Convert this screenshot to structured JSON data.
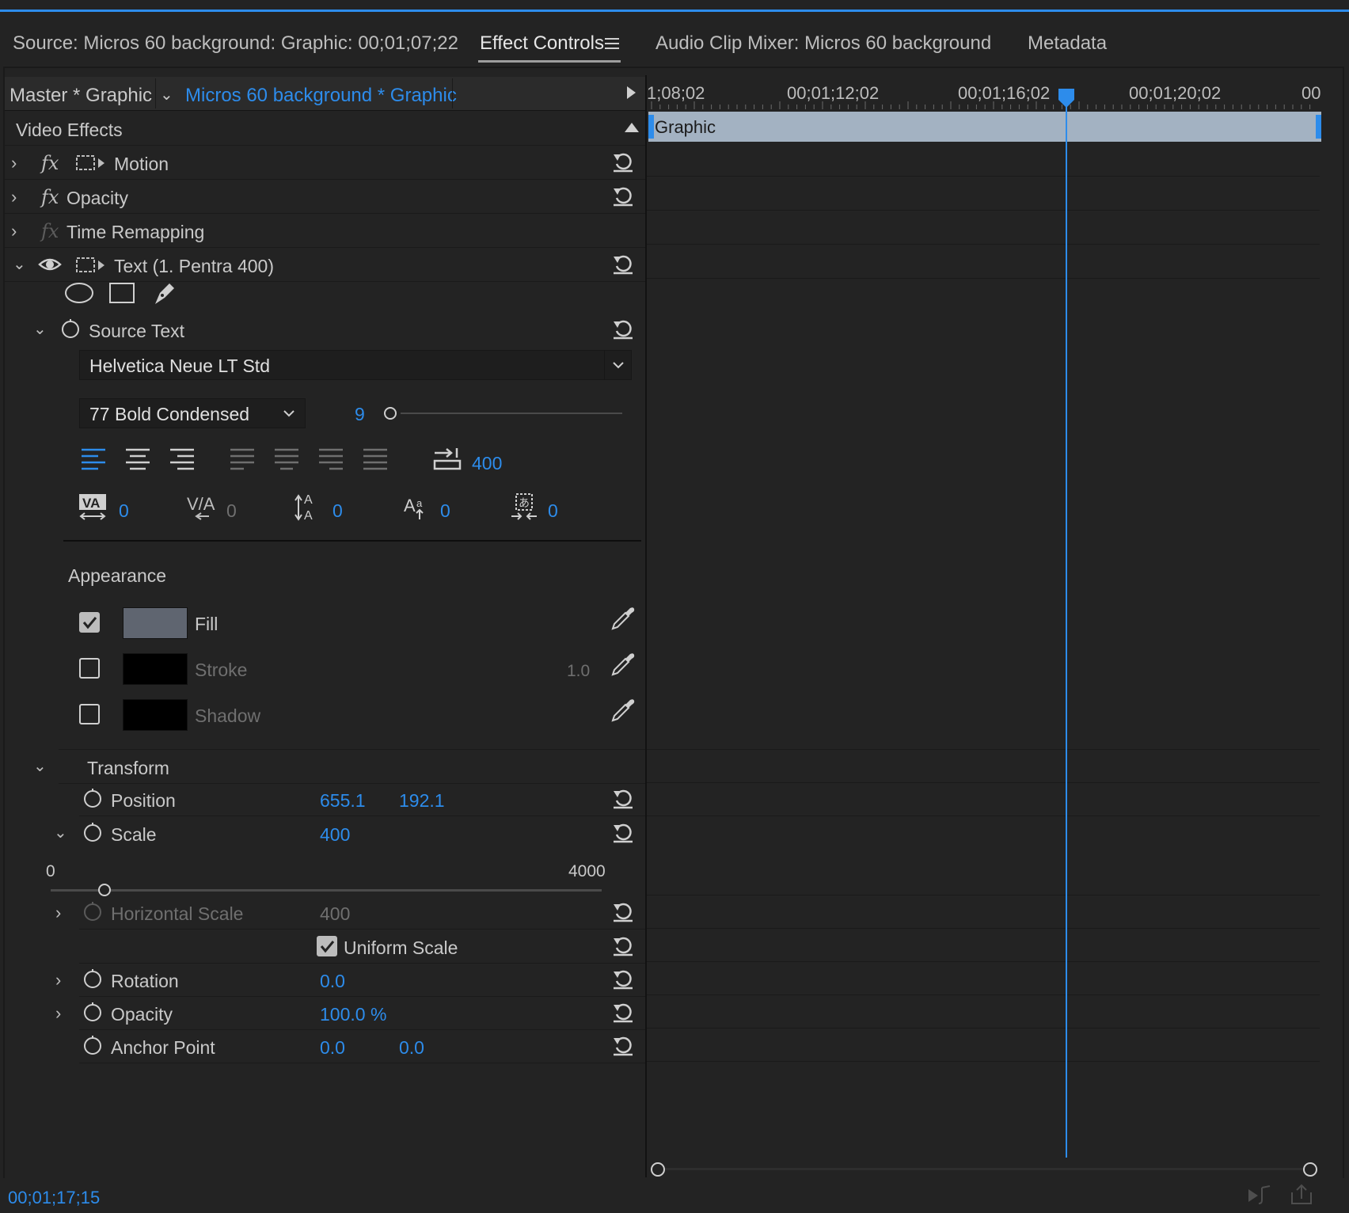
{
  "tabs": {
    "source": "Source: Micros 60 background: Graphic: 00;01;07;22",
    "effect_controls": "Effect Controls",
    "audio_clip_mixer": "Audio Clip Mixer: Micros 60 background",
    "metadata": "Metadata"
  },
  "header": {
    "master": "Master * Graphic",
    "clip": "Micros 60 background * Graphic"
  },
  "video_effects_label": "Video Effects",
  "effects": {
    "motion": "Motion",
    "opacity": "Opacity",
    "time_remapping": "Time Remapping",
    "text_layer": "Text (1. Pentra 400)"
  },
  "source_text": {
    "label": "Source Text",
    "font_family": "Helvetica Neue LT Std",
    "font_style": "77 Bold Condensed",
    "font_size": "9",
    "tab_width": "400",
    "kerning": "0",
    "tracking": "0",
    "leading": "0",
    "baseline_shift": "0",
    "tsume": "0"
  },
  "appearance": {
    "label": "Appearance",
    "fill": {
      "label": "Fill",
      "checked": true,
      "color": "#5f6570"
    },
    "stroke": {
      "label": "Stroke",
      "checked": false,
      "color": "#000000",
      "width": "1.0"
    },
    "shadow": {
      "label": "Shadow",
      "checked": false,
      "color": "#000000"
    }
  },
  "transform": {
    "label": "Transform",
    "position_label": "Position",
    "position_x": "655.1",
    "position_y": "192.1",
    "scale_label": "Scale",
    "scale": "400",
    "scale_min": "0",
    "scale_max": "4000",
    "horizontal_scale_label": "Horizontal Scale",
    "horizontal_scale": "400",
    "uniform_scale_label": "Uniform Scale",
    "uniform_scale_checked": true,
    "rotation_label": "Rotation",
    "rotation": "0.0",
    "opacity_label": "Opacity",
    "opacity": "100.0 %",
    "anchor_label": "Anchor Point",
    "anchor_x": "0.0",
    "anchor_y": "0.0"
  },
  "timeline": {
    "ticks": [
      "1;08;02",
      "00;01;12;02",
      "00;01;16;02",
      "00;01;20;02",
      "00"
    ],
    "clip_label": "Graphic"
  },
  "current_timecode": "00;01;17;15",
  "colors": {
    "accent": "#2d8ceb",
    "panel_bg": "#232323",
    "clip_bar": "#a3b2c2"
  }
}
